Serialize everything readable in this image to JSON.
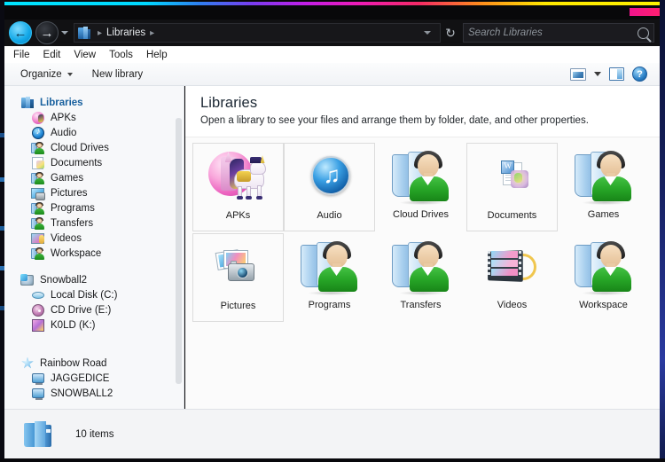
{
  "window": {
    "title": "Libraries"
  },
  "addressbar": {
    "back_icon": "back-arrow-icon",
    "forward_icon": "forward-arrow-icon",
    "recent_icon": "recent-pages-chevron-icon",
    "path_icon": "libraries-icon",
    "crumb": "Libraries",
    "separator": "▸",
    "refresh_icon": "refresh-icon",
    "dropdown_icon": "address-dropdown-icon"
  },
  "search": {
    "placeholder": "Search Libraries",
    "value": "",
    "icon": "search-icon"
  },
  "menu": {
    "items": [
      "File",
      "Edit",
      "View",
      "Tools",
      "Help"
    ]
  },
  "toolbar": {
    "organize_label": "Organize",
    "new_library_label": "New library",
    "change_view_icon": "change-view-icon",
    "view_caret_icon": "chevron-down-icon",
    "preview_pane_icon": "preview-pane-icon",
    "help_icon": "help-icon",
    "help_glyph": "?"
  },
  "sidebar": {
    "libraries_header": {
      "label": "Libraries",
      "icon": "libraries-icon"
    },
    "library_items": [
      {
        "label": "APKs",
        "icon": "apks-library-icon"
      },
      {
        "label": "Audio",
        "icon": "audio-library-icon"
      },
      {
        "label": "Cloud Drives",
        "icon": "library-person-icon"
      },
      {
        "label": "Documents",
        "icon": "documents-library-icon"
      },
      {
        "label": "Games",
        "icon": "library-person-icon"
      },
      {
        "label": "Pictures",
        "icon": "pictures-library-icon"
      },
      {
        "label": "Programs",
        "icon": "library-person-icon"
      },
      {
        "label": "Transfers",
        "icon": "library-person-icon"
      },
      {
        "label": "Videos",
        "icon": "videos-library-icon"
      },
      {
        "label": "Workspace",
        "icon": "library-person-icon"
      }
    ],
    "computer": {
      "label": "Snowball2",
      "icon": "computer-icon",
      "drives": [
        {
          "label": "Local Disk (C:)",
          "icon": "hard-drive-icon"
        },
        {
          "label": "CD Drive (E:)",
          "icon": "cd-drive-icon"
        },
        {
          "label": "K0LD (K:)",
          "icon": "removable-drive-icon"
        }
      ]
    },
    "network": {
      "label": "Rainbow Road",
      "icon": "network-icon",
      "computers": [
        {
          "label": "JAGGEDICE",
          "icon": "network-computer-icon"
        },
        {
          "label": "SNOWBALL2",
          "icon": "network-computer-icon"
        }
      ]
    }
  },
  "content": {
    "heading": "Libraries",
    "subheading": "Open a library to see your files and arrange them by folder, date, and other properties.",
    "tiles": [
      {
        "label": "APKs",
        "icon": "apks-library-tile",
        "selected": true
      },
      {
        "label": "Audio",
        "icon": "audio-library-tile",
        "selected": true
      },
      {
        "label": "Cloud Drives",
        "icon": "library-person-tile",
        "selected": false
      },
      {
        "label": "Documents",
        "icon": "documents-library-tile",
        "selected": true
      },
      {
        "label": "Games",
        "icon": "library-person-tile",
        "selected": false
      },
      {
        "label": "Pictures",
        "icon": "pictures-library-tile",
        "selected": true
      },
      {
        "label": "Programs",
        "icon": "library-person-tile",
        "selected": false
      },
      {
        "label": "Transfers",
        "icon": "library-person-tile",
        "selected": false
      },
      {
        "label": "Videos",
        "icon": "videos-library-tile",
        "selected": false
      },
      {
        "label": "Workspace",
        "icon": "library-person-tile",
        "selected": false
      }
    ]
  },
  "status": {
    "icon": "folder-icon",
    "text": "10 items"
  },
  "colors": {
    "accent_back_button": "#13a9e8",
    "heading_text": "#1b2733",
    "sidebar_header_text": "#18609e",
    "library_shirt_green": "#25a325",
    "chrome_black": "#111113",
    "window_border_blue": "#2a3aa0",
    "caption_nub_pink": "#f0148c"
  }
}
